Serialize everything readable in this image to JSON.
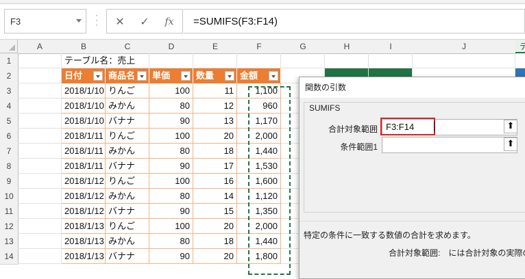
{
  "formula_bar": {
    "name_box": "F3",
    "cancel_icon": "✕",
    "enter_icon": "✓",
    "fx_icon": "fx",
    "formula": "=SUMIFS(F3:F14)"
  },
  "grid": {
    "columns": [
      "A",
      "B",
      "C",
      "D",
      "E",
      "F",
      "G",
      "H",
      "I",
      "J",
      "テ"
    ],
    "rows": [
      "1",
      "2",
      "3",
      "4",
      "5",
      "6",
      "7",
      "8",
      "9",
      "10",
      "11",
      "12",
      "13",
      "14"
    ],
    "table_caption": "テーブル名：売上",
    "table_headers": [
      "日付",
      "商品名",
      "単価",
      "数量",
      "金額"
    ],
    "table_rows": [
      [
        "2018/1/10",
        "りんご",
        "100",
        "11",
        "1,100"
      ],
      [
        "2018/1/10",
        "みかん",
        "80",
        "12",
        "960"
      ],
      [
        "2018/1/10",
        "バナナ",
        "90",
        "13",
        "1,170"
      ],
      [
        "2018/1/11",
        "りんご",
        "100",
        "20",
        "2,000"
      ],
      [
        "2018/1/11",
        "みかん",
        "80",
        "18",
        "1,440"
      ],
      [
        "2018/1/11",
        "バナナ",
        "90",
        "17",
        "1,530"
      ],
      [
        "2018/1/12",
        "りんご",
        "100",
        "16",
        "1,600"
      ],
      [
        "2018/1/12",
        "みかん",
        "80",
        "14",
        "1,120"
      ],
      [
        "2018/1/12",
        "バナナ",
        "90",
        "15",
        "1,350"
      ],
      [
        "2018/1/13",
        "りんご",
        "100",
        "20",
        "2,000"
      ],
      [
        "2018/1/13",
        "みかん",
        "80",
        "18",
        "1,440"
      ],
      [
        "2018/1/13",
        "バナナ",
        "90",
        "20",
        "1,800"
      ]
    ]
  },
  "dialog": {
    "title": "関数の引数",
    "function_name": "SUMIFS",
    "arg1_label": "合計対象範囲",
    "arg1_value": "F3:F14",
    "arg2_label": "条件範囲1",
    "arg2_value": "",
    "collapse_icon": "⬆",
    "description": "特定の条件に一致する数値の合計を求めます。",
    "arg_description": "合計対象範囲:　には合計対象の実際のセ"
  },
  "colors": {
    "table_header": "#ed7d31",
    "table_border": "#f4b183",
    "marquee": "#217346",
    "accent_cell": "#217346"
  }
}
